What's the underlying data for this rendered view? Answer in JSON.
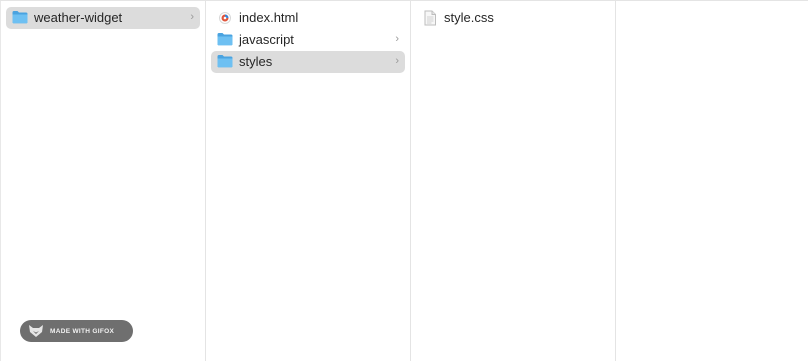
{
  "columns": [
    {
      "items": [
        {
          "label": "weather-widget",
          "icon": "folder-icon",
          "has_children": true,
          "selected": true
        }
      ]
    },
    {
      "items": [
        {
          "label": "index.html",
          "icon": "html-file-icon",
          "has_children": false,
          "selected": false
        },
        {
          "label": "javascript",
          "icon": "folder-icon",
          "has_children": true,
          "selected": false
        },
        {
          "label": "styles",
          "icon": "folder-icon",
          "has_children": true,
          "selected": true
        }
      ]
    },
    {
      "items": [
        {
          "label": "style.css",
          "icon": "css-file-icon",
          "has_children": false,
          "selected": false
        }
      ]
    },
    {
      "items": []
    }
  ],
  "watermark": {
    "text": "MADE WITH GIFOX",
    "icon": "fox-icon",
    "color": "#6f6f6f"
  },
  "colors": {
    "selection": "#dcdcdc",
    "folder": "#5fb3ea",
    "chevron": "#9a9a9a"
  },
  "chevron_glyph": "›"
}
